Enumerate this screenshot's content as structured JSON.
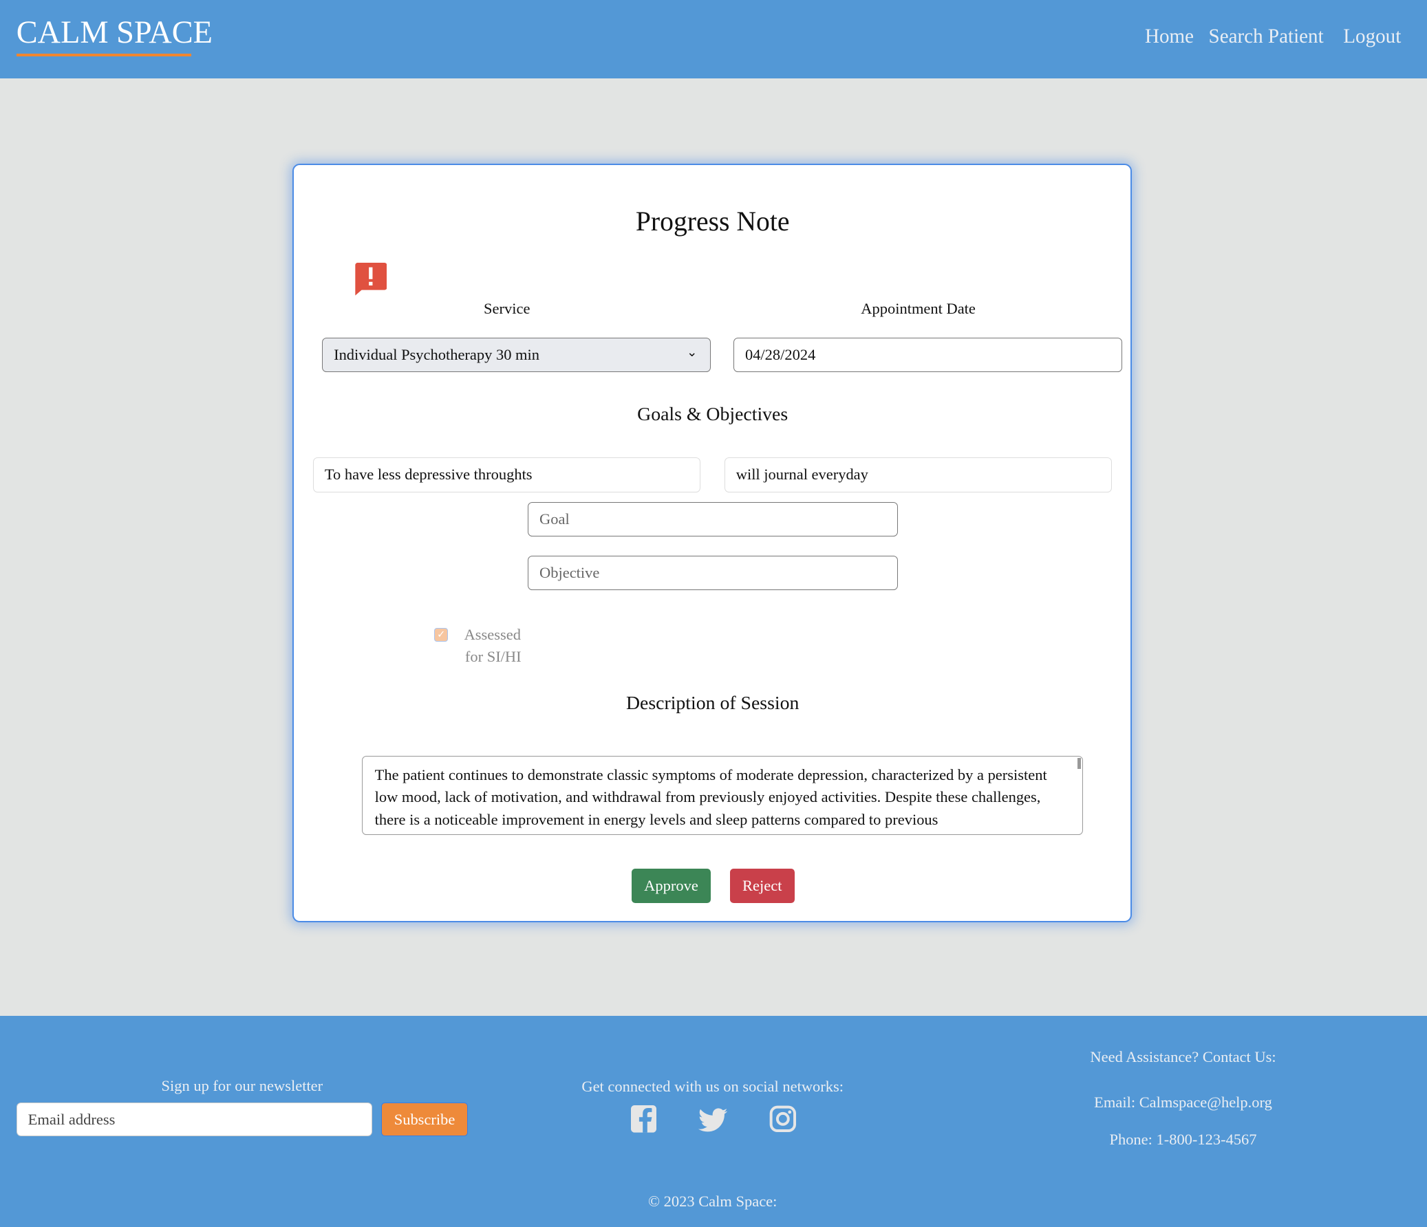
{
  "header": {
    "logo": "CALM SPACE",
    "nav": [
      "Home",
      "Search Patient",
      "Logout"
    ]
  },
  "form": {
    "title": "Progress Note",
    "alert_icon": "alert-message-icon",
    "service_label": "Service",
    "service_value": "Individual Psychotherapy 30 min",
    "date_label": "Appointment Date",
    "date_value": "04/28/2024",
    "goals_heading": "Goals & Objectives",
    "existing_goal": "To have less depressive throughts",
    "existing_objective": "will journal everyday",
    "goal_placeholder": "Goal",
    "objective_placeholder": "Objective",
    "assessed_checked": true,
    "assessed_label_1": "Assessed",
    "assessed_label_2": "for SI/HI",
    "description_heading": "Description of Session",
    "description": "The patient continues to demonstrate classic symptoms of moderate depression, characterized by a persistent low mood, lack of motivation, and withdrawal from previously enjoyed activities. Despite these challenges, there is a noticeable improvement in energy levels and sleep patterns compared to previous",
    "approve": "Approve",
    "reject": "Reject"
  },
  "footer": {
    "newsletter_title": "Sign up for our newsletter",
    "email_placeholder": "Email address",
    "subscribe": "Subscribe",
    "social_title": "Get connected with us on social networks:",
    "social_icons": [
      "facebook-icon",
      "twitter-icon",
      "instagram-icon"
    ],
    "contact_title": "Need Assistance? Contact Us:",
    "contact_email": "Email: Calmspace@help.org",
    "contact_phone": "Phone: 1-800-123-4567",
    "copyright": "© 2023 Calm Space:"
  },
  "colors": {
    "brand": "#5398d6",
    "accent": "#f0862f",
    "approve": "#3c8656",
    "reject": "#c9404a",
    "alert": "#e05140"
  }
}
